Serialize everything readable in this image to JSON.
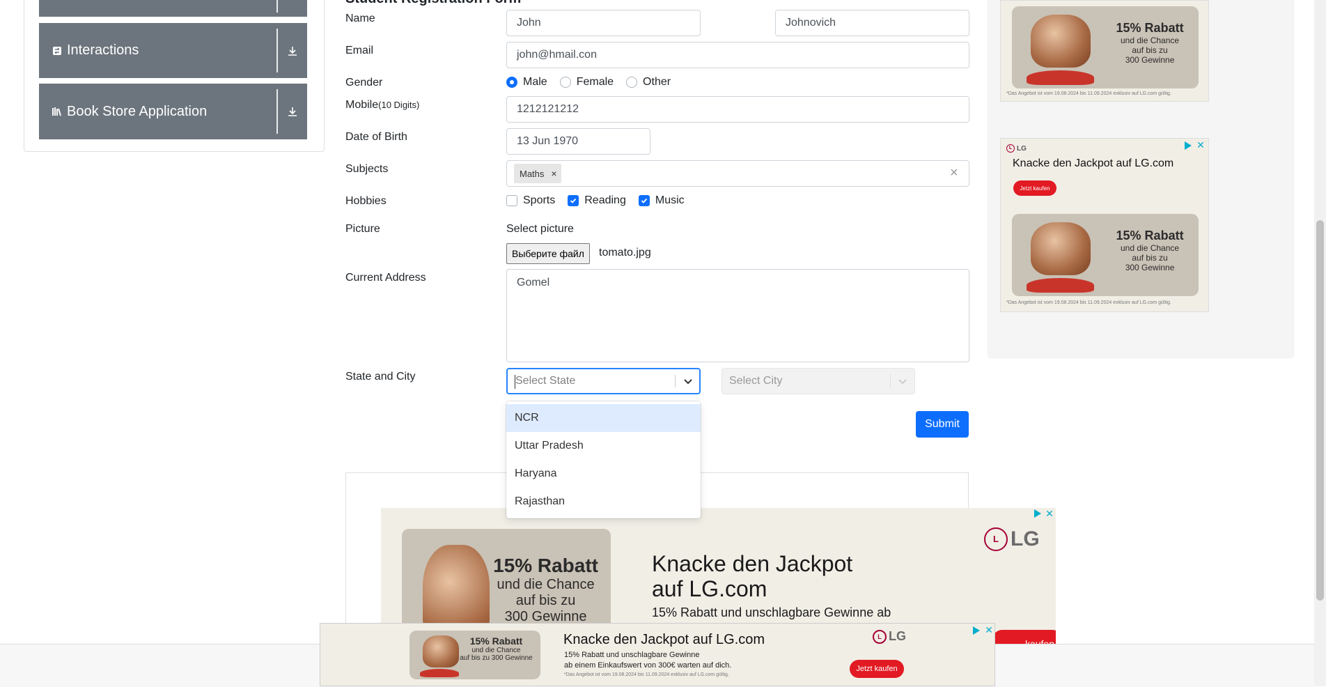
{
  "sidebar": {
    "groups": [
      {
        "label": "Interactions",
        "icon": "interactions-icon"
      },
      {
        "label": "Book Store Application",
        "icon": "book-icon"
      }
    ]
  },
  "form": {
    "title": "Student Registration Form",
    "name": {
      "label": "Name",
      "first": "John",
      "last": "Johnovich"
    },
    "email": {
      "label": "Email",
      "value": "john@hmail.con"
    },
    "gender": {
      "label": "Gender",
      "options": [
        "Male",
        "Female",
        "Other"
      ],
      "selected": "Male"
    },
    "mobile": {
      "label": "Mobile",
      "hint": "(10 Digits)",
      "value": "1212121212"
    },
    "dob": {
      "label": "Date of Birth",
      "value": "13 Jun 1970"
    },
    "subjects": {
      "label": "Subjects",
      "chips": [
        "Maths"
      ],
      "chip_remove": "×",
      "clear": "×"
    },
    "hobbies": {
      "label": "Hobbies",
      "options": [
        {
          "label": "Sports",
          "checked": false
        },
        {
          "label": "Reading",
          "checked": true
        },
        {
          "label": "Music",
          "checked": true
        }
      ]
    },
    "picture": {
      "label": "Picture",
      "prompt": "Select picture",
      "button": "Выберите файл",
      "filename": "tomato.jpg"
    },
    "address": {
      "label": "Current Address",
      "value": "Gomel"
    },
    "state_city": {
      "label": "State and City",
      "state_placeholder": "Select State",
      "city_placeholder": "Select City",
      "state_options": [
        "NCR",
        "Uttar Pradesh",
        "Haryana",
        "Rajasthan"
      ],
      "focused_option": "NCR"
    },
    "submit": "Submit"
  },
  "ads": {
    "headline": "Knacke den Jackpot auf LG.com",
    "headline_line1": "Knacke den Jackpot",
    "headline_line2": "auf LG.com",
    "sub": "15% Rabatt und unschlagbare Gewinne ab",
    "sub_short1": "15% Rabatt und unschlagbare Gewinne",
    "sub_short2": "ab einem Einkaufswert von 300€ warten auf dich.",
    "rabatt": "15% Rabatt",
    "chance1": "und die Chance",
    "chance2": "auf bis zu",
    "chance3": "300 Gewinne",
    "chance_short": "auf bis zu 300 Gewinne",
    "cta": "Jetzt kaufen",
    "cta_cut": "kaufen",
    "fine": "*Das Angebot ist vom 19.08.2024 bis 11.09.2024 exklusiv auf LG.com gültig.",
    "brand": "LG",
    "accent": "#a50034",
    "cta_color": "#e21a23"
  },
  "colors": {
    "sidebar_header": "#6c757d",
    "primary": "#0d6efd",
    "option_focus": "#deebff"
  }
}
